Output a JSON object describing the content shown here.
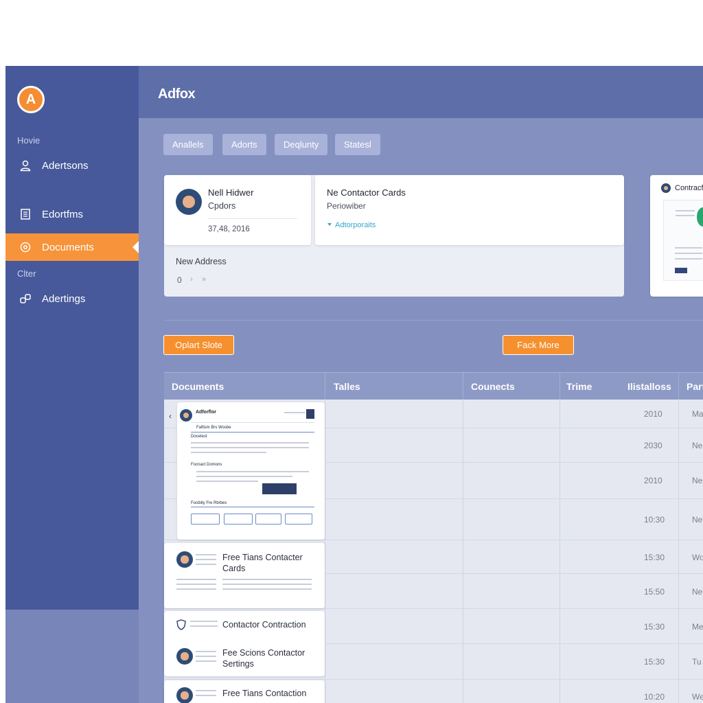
{
  "app": {
    "title": "Adfox",
    "logo_letter": "A"
  },
  "sidebar": {
    "section_home": "Hovie",
    "section_other": "Clter",
    "items": [
      {
        "label": "Adertsons",
        "icon": "user-icon"
      },
      {
        "label": "Edortfms",
        "icon": "document-icon"
      },
      {
        "label": "Documents",
        "icon": "gear-icon",
        "active": true
      },
      {
        "label": "Adertings",
        "icon": "link-icon"
      }
    ]
  },
  "tabs": [
    "Anallels",
    "Adorts",
    "Deqlunty",
    "Statesl"
  ],
  "profile_card": {
    "name": "Nell Hidwer",
    "role": "Cpdors",
    "date": "37,48, 2016"
  },
  "address_panel": {
    "label": "New Address",
    "count": "0"
  },
  "contact_card": {
    "title": "Ne Contactor Cards",
    "subtitle": "Periowiber",
    "link": "Adtorporaits"
  },
  "side_card": {
    "title": "Contracf"
  },
  "buttons": {
    "left": "Oplart Slote",
    "right": "Fack More"
  },
  "table": {
    "headers": [
      "Documents",
      "Talles",
      "Counects",
      "Trime",
      "Ilistalloss",
      "Part"
    ],
    "rows": [
      {
        "time": "2010",
        "part": "Ma"
      },
      {
        "time": "2030",
        "part": "Ne"
      },
      {
        "time": "2010",
        "part": "Ne"
      },
      {
        "time": "10:30",
        "part": "Ne"
      },
      {
        "time": "15:30",
        "part": "Wo"
      },
      {
        "time": "15:50",
        "part": "Ne"
      },
      {
        "time": "15:30",
        "part": "Me"
      },
      {
        "time": "15:30",
        "part": "Tu"
      },
      {
        "time": "10:20",
        "part": "We"
      }
    ]
  },
  "documents": [
    {
      "title": "Free Tians Contacter Cards"
    },
    {
      "title": "Contactor Contraction"
    },
    {
      "title": "Fee Scions Contactor Sertings"
    },
    {
      "title": "Free Tians Contaction"
    }
  ],
  "preview": {
    "heading": "Adforflor",
    "sub": "Faftism Brs Wosbe",
    "section1": "Docetest",
    "section2": "Focnact Domons",
    "section3": "Focibity Fre Rbrbes"
  }
}
